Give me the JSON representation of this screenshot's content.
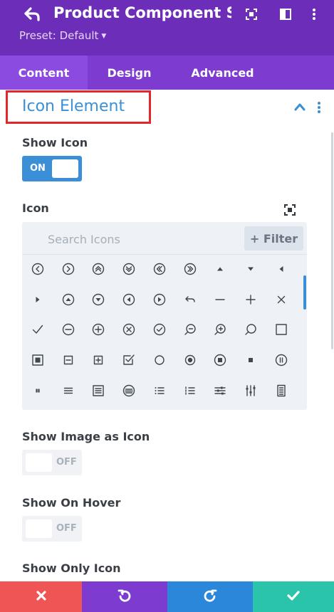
{
  "header": {
    "title": "Product Component S...",
    "preset": "Preset: Default",
    "icons": [
      "back-arrow-icon",
      "fullscreen-icon",
      "split-view-icon",
      "more-vertical-icon"
    ]
  },
  "tabs": [
    {
      "label": "Content",
      "active": true
    },
    {
      "label": "Design",
      "active": false
    },
    {
      "label": "Advanced",
      "active": false
    }
  ],
  "section": {
    "title": "Icon Element"
  },
  "fields": {
    "show_icon": {
      "label": "Show Icon",
      "state": "ON"
    },
    "icon": {
      "label": "Icon"
    },
    "show_image_as_icon": {
      "label": "Show Image as Icon",
      "state": "OFF"
    },
    "show_on_hover": {
      "label": "Show On Hover",
      "state": "OFF"
    },
    "show_only_icon": {
      "label": "Show Only Icon"
    }
  },
  "icon_picker": {
    "search_placeholder": "Search Icons",
    "filter_label": "+ Filter",
    "icons": [
      "circle-chevron-left-icon",
      "circle-chevron-right-icon",
      "circle-double-up-icon",
      "circle-double-down-icon",
      "circle-double-left-icon",
      "circle-double-right-icon",
      "triangle-up-icon",
      "triangle-down-icon",
      "triangle-left-icon",
      "triangle-right-icon",
      "circle-triangle-up-icon",
      "circle-triangle-down-icon",
      "circle-triangle-left-icon",
      "circle-triangle-right-icon",
      "undo-arrow-icon",
      "minus-icon",
      "plus-icon",
      "close-x-icon",
      "checkmark-icon",
      "circle-minus-icon",
      "circle-plus-icon",
      "circle-x-icon",
      "circle-check-icon",
      "zoom-out-icon",
      "zoom-in-icon",
      "search-icon",
      "square-outline-icon",
      "square-filled-box-icon",
      "square-minus-icon",
      "square-plus-icon",
      "square-check-icon",
      "circle-outline-icon",
      "circle-dot-icon",
      "circle-stop-icon",
      "small-square-icon",
      "circle-pause-icon",
      "pause-icon",
      "menu-lines-icon",
      "doc-lines-icon",
      "circle-lines-icon",
      "list-bullets-icon",
      "list-numbered-icon",
      "sliders-horizontal-icon",
      "sliders-vertical-icon",
      "document-text-icon"
    ]
  },
  "footer": [
    {
      "name": "discard-button",
      "icon": "close-x-icon",
      "color": "#ef5555"
    },
    {
      "name": "undo-button",
      "icon": "undo-icon",
      "color": "#7e3bd0"
    },
    {
      "name": "redo-button",
      "icon": "redo-icon",
      "color": "#2b87da"
    },
    {
      "name": "save-button",
      "icon": "checkmark-icon",
      "color": "#29c4a9"
    }
  ],
  "colors": {
    "header": "#6c2eb9",
    "tabs": "#7d3bcf",
    "accent": "#3a8fd6",
    "highlight_box": "#e3272d"
  }
}
